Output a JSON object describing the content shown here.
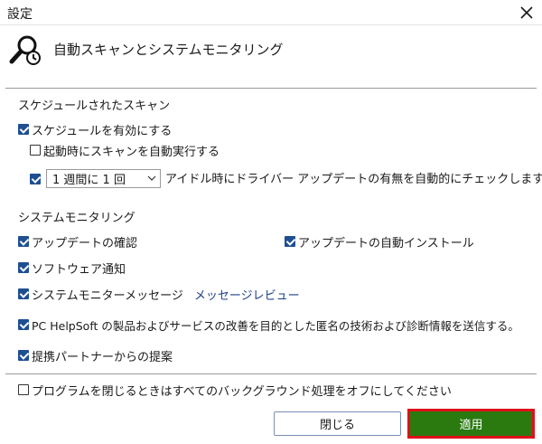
{
  "window": {
    "title": "設定"
  },
  "header": {
    "title": "自動スキャンとシステムモニタリング"
  },
  "scheduled": {
    "section_title": "スケジュールされたスキャン",
    "enable_label": "スケジュールを有効にする",
    "enable_checked": true,
    "startup_label": "起動時にスキャンを自動実行する",
    "startup_checked": false,
    "frequency_checked": true,
    "frequency_value": "1 週間に 1 回",
    "frequency_suffix": "アイドル時にドライバー アップデートの有無を自動的にチェックします"
  },
  "monitoring": {
    "section_title": "システムモニタリング",
    "update_check_label": "アップデートの確認",
    "update_auto_install_label": "アップデートの自動インストール",
    "software_notify_label": "ソフトウェア通知",
    "system_monitor_label": "システムモニターメッセージ",
    "message_review_link": "メッセージレビュー",
    "anon_info_label": "PC HelpSoft の製品およびサービスの改善を目的とした匿名の技術および診断情報を送信する。",
    "partner_offers_label": "提携パートナーからの提案"
  },
  "footer": {
    "background_off_label": "プログラムを閉じるときはすべてのバックグラウンド処理をオフにしてください",
    "background_off_checked": false,
    "close_button": "閉じる",
    "apply_button": "適用"
  },
  "colors": {
    "accent": "#1e4f91",
    "apply_bg": "#2a7a10",
    "apply_border": "#e0101a",
    "link": "#1d3f8a"
  }
}
